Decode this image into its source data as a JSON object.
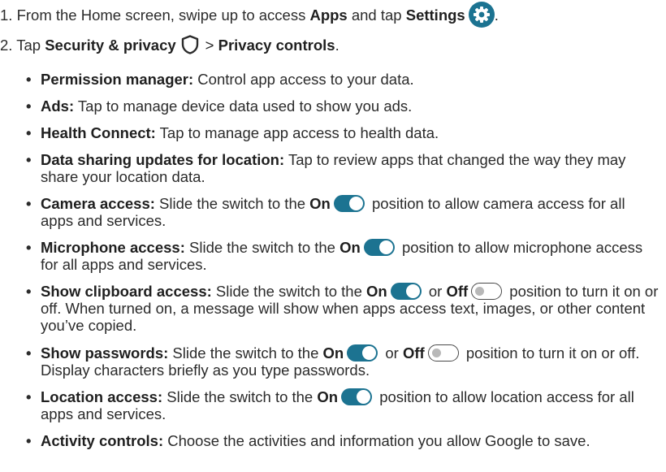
{
  "step1": {
    "text": "1. From the Home screen, swipe up to access ",
    "apps": "Apps",
    "mid": " and tap ",
    "settings": "Settings",
    "end": "."
  },
  "step2": {
    "text": "2. Tap ",
    "security": "Security & privacy",
    "sep": "> ",
    "privacy": "Privacy controls",
    "end": "."
  },
  "bullets": [
    {
      "title": "Permission manager:",
      "body": " Control app access to your data."
    },
    {
      "title": "Ads:",
      "body": " Tap to manage device data used to show you ads."
    },
    {
      "title": "Health Connect:",
      "body": " Tap to manage app access to health data."
    },
    {
      "title": "Data sharing updates for location:",
      "body": " Tap to review apps that changed the way they may share your location data."
    },
    {
      "title": "Camera access:",
      "a": " Slide the switch to the ",
      "on": "On",
      "b": " position to allow camera access for all apps and services."
    },
    {
      "title": "Microphone access:",
      "a": " Slide the switch to the ",
      "on": "On",
      "b": " position to allow microphone access for all apps and services."
    },
    {
      "title": "Show clipboard access:",
      "a": " Slide the switch to the ",
      "on": "On",
      "mid": " or ",
      "off": "Off",
      "b": " position to turn it on or off. When turned on, a message will show when apps access text, images, or other content you’ve copied."
    },
    {
      "title": "Show passwords:",
      "a": " Slide the switch to the ",
      "on": "On",
      "mid": " or ",
      "off": "Off",
      "b": " position to turn it on or off. Display characters briefly as you type passwords."
    },
    {
      "title": "Location access:",
      "a": " Slide the switch to the ",
      "on": "On",
      "b": " position to allow location access for all apps and services."
    },
    {
      "title": "Activity controls:",
      "body": " Choose the activities and information you allow Google to save."
    }
  ],
  "bullet_char": "•",
  "icons": {
    "settings": "gear-icon",
    "security": "shield-icon",
    "switch_on": "toggle-on-icon",
    "switch_off": "toggle-off-icon"
  },
  "colors": {
    "accent": "#1c7391",
    "text": "#2b2b2b"
  }
}
